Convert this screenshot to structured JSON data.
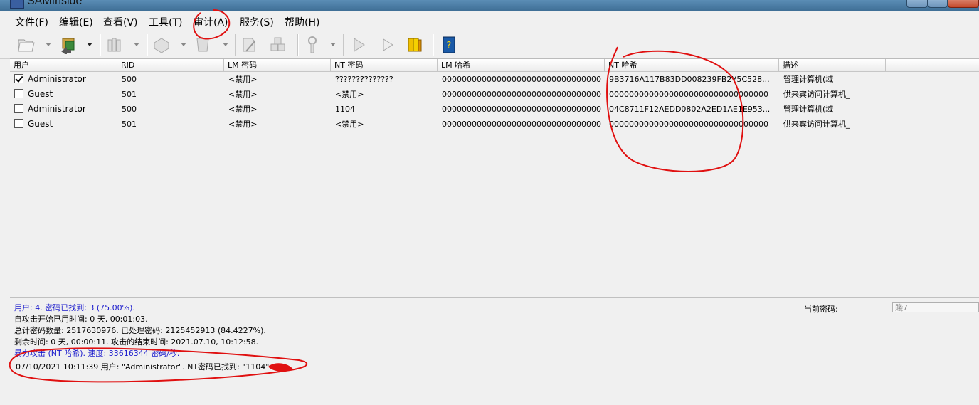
{
  "window": {
    "title": "SAMInside"
  },
  "menu": [
    {
      "id": "file",
      "label": "文件(F)"
    },
    {
      "id": "edit",
      "label": "编辑(E)"
    },
    {
      "id": "view",
      "label": "查看(V)"
    },
    {
      "id": "tools",
      "label": "工具(T)"
    },
    {
      "id": "audit",
      "label": "审计(A)"
    },
    {
      "id": "service",
      "label": "服务(S)"
    },
    {
      "id": "help",
      "label": "帮助(H)"
    }
  ],
  "toolbar": {
    "icons": [
      "open-folder-icon",
      "import-icon",
      "users-icon",
      "print-icon",
      "delete-icon",
      "audit-icon",
      "computers-icon",
      "tools-icon",
      "back-icon",
      "play-icon",
      "books-icon",
      "help-book-icon"
    ]
  },
  "columns": [
    "用户",
    "RID",
    "LM 密码",
    "NT 密码",
    "LM 哈希",
    "NT 哈希",
    "描述"
  ],
  "rows": [
    {
      "checked": true,
      "user": "Administrator",
      "rid": "500",
      "lm_pw": "<禁用>",
      "nt_pw": "??????????????",
      "lm_hash": "00000000000000000000000000000000",
      "nt_hash": "9B3716A117B83DD008239FB2¥5C528...",
      "desc": "管理计算机(域"
    },
    {
      "checked": false,
      "user": "Guest",
      "rid": "501",
      "lm_pw": "<禁用>",
      "nt_pw": "<禁用>",
      "lm_hash": "00000000000000000000000000000000",
      "nt_hash": "00000000000000000000000000000000",
      "desc": "供来宾访问计算机_"
    },
    {
      "checked": false,
      "user": "Administrator",
      "rid": "500",
      "lm_pw": "<禁用>",
      "nt_pw": "1104",
      "lm_hash": "00000000000000000000000000000000",
      "nt_hash": "04C8711F12AEDD0802A2ED1AE1E953...",
      "desc": "管理计算机(域"
    },
    {
      "checked": false,
      "user": "Guest",
      "rid": "501",
      "lm_pw": "<禁用>",
      "nt_pw": "<禁用>",
      "lm_hash": "00000000000000000000000000000000",
      "nt_hash": "00000000000000000000000000000000",
      "desc": "供来宾访问计算机_"
    }
  ],
  "status": {
    "lines": [
      {
        "text": "用户: 4. 密码已找到: 3 (75.00%).",
        "color": "blue"
      },
      {
        "text": "自攻击开始已用时间: 0 天, 00:01:03.",
        "color": "black"
      },
      {
        "text": "总计密码数量: 2517630976. 已处理密码: 2125452913 (84.4227%).",
        "color": "black"
      },
      {
        "text": "剩余时间: 0 天, 00:00:11. 攻击的结束时间: 2021.07.10, 10:12:58.",
        "color": "black"
      },
      {
        "text": "暴力攻击 (NT 哈希). 速度: 33616344 密码/秒.",
        "color": "blue"
      },
      {
        "text": "07/10/2021 10:11:39 用户: \"Administrator\". NT密码已找到: \"1104\"",
        "color": "black"
      }
    ],
    "current_password_label": "当前密码:",
    "current_password_value": "賤7"
  },
  "colors": {
    "annotation": "#e01010",
    "link_blue": "#1a1acc"
  }
}
